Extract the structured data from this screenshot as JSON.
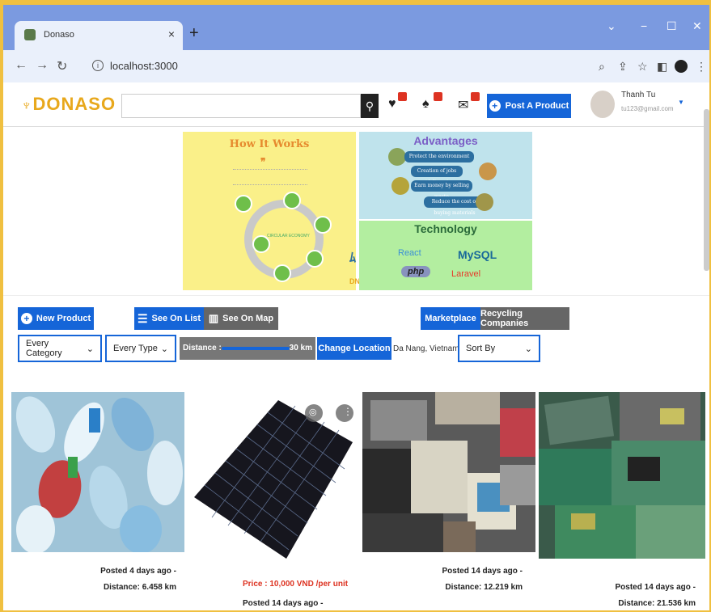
{
  "browser": {
    "tab_title": "Donaso",
    "url": "localhost:3000",
    "new_tab": "+",
    "tab_close": "×"
  },
  "header": {
    "logo": "DONASO",
    "search_placeholder": "",
    "post_button": "Post A Product",
    "user_name": "Thanh Tu",
    "user_email": "tu123@gmail.com",
    "icons": [
      "search-icon",
      "heart-icon",
      "bell-icon",
      "mail-icon"
    ]
  },
  "banner": {
    "how_title": "How It Works",
    "cycle_label": "CIRCULAR ECONOMY",
    "dnet": "DNET",
    "adv_title": "Advantages",
    "adv_items": [
      "Protect the environment",
      "Creation of jobs (delivery)",
      "Earn money by selling waste",
      "Reduce the cost of buying materials"
    ],
    "tech_title": "Technology",
    "tech_logos": [
      "React",
      "MySQL",
      "php",
      "Laravel"
    ]
  },
  "toolbar": {
    "new_product": "New Product",
    "see_on_list": "See On List",
    "see_on_map": "See On Map",
    "marketplace": "Marketplace",
    "recycling": "Recycling Companies",
    "category": "Every Category",
    "type": "Every Type",
    "distance_label": "Distance :",
    "distance_value": "30 km",
    "distance_fraction": 0.6,
    "change_location": "Change Location",
    "location": "Da Nang, Vietnam",
    "sort_by": "Sort By"
  },
  "products": [
    {
      "posted": "Posted 4 days ago -",
      "distance": "Distance: 6.458 km",
      "price": ""
    },
    {
      "posted": "Posted 14 days ago -",
      "distance": "",
      "price": "Price : 10,000 VND /per unit"
    },
    {
      "posted": "Posted 14 days ago -",
      "distance": "Distance: 12.219 km",
      "price": ""
    },
    {
      "posted": "Posted 14 days ago -",
      "distance": "Distance: 21.536 km",
      "price": ""
    }
  ],
  "colors": {
    "accent": "#1565d8",
    "logo": "#e8a81c",
    "badge": "#dd3322",
    "price": "#dd3322"
  }
}
